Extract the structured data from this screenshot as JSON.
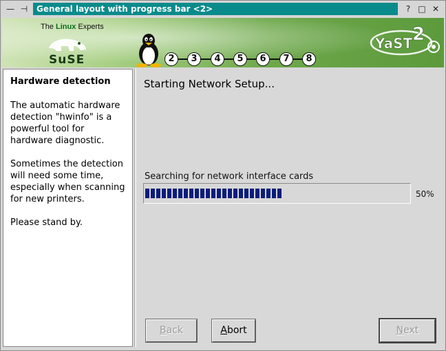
{
  "window": {
    "title": "General layout with progress bar <2>",
    "controls": [
      "minimize-icon",
      "pin-icon",
      "help-icon",
      "maximize-icon",
      "close-icon"
    ]
  },
  "banner": {
    "tagline_prefix": "The ",
    "tagline_brand": "Linux",
    "tagline_suffix": " Experts",
    "suse_word": "SuSE",
    "steps": [
      "2",
      "3",
      "4",
      "5",
      "6",
      "7",
      "8"
    ],
    "yast_logo": "YaST2"
  },
  "help": {
    "title": "Hardware detection",
    "paragraphs": [
      "The automatic hardware detection \"hwinfo\" is a powerful tool for hardware diagnostic.",
      "Sometimes the detection will need some time, especially when scanning for new printers.",
      "Please stand by."
    ]
  },
  "main": {
    "heading": "Starting Network Setup...",
    "progress_label": "Searching for network interface cards",
    "progress_percent": 50,
    "progress_text": "50%"
  },
  "buttons": {
    "back_label": "Back",
    "back_mnemonic": "B",
    "back_rest": "ack",
    "abort_mnemonic": "A",
    "abort_rest": "bort",
    "next_mnemonic": "N",
    "next_rest": "ext"
  },
  "colors": {
    "title_bg": "#0a8b8b",
    "progress_fill": "#0b1d7c",
    "banner_green": "#6ea84b"
  }
}
